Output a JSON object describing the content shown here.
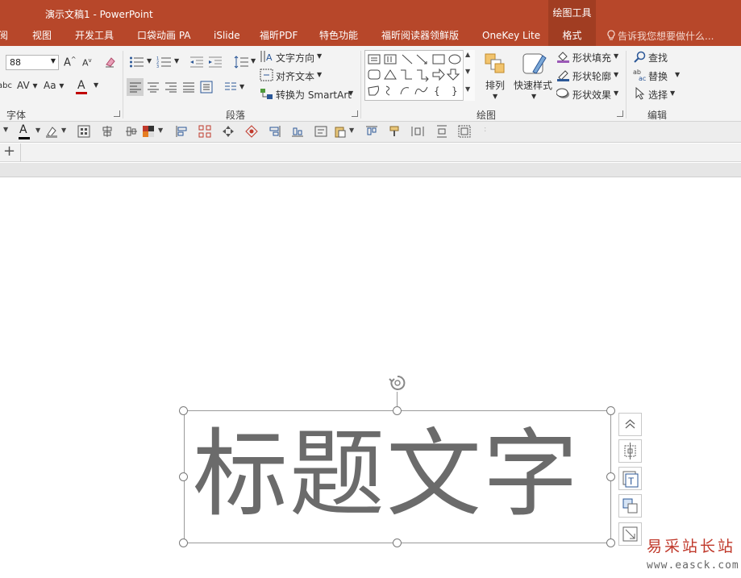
{
  "window": {
    "title": "演示文稿1 - PowerPoint",
    "context_tab_group": "绘图工具"
  },
  "tabs": [
    {
      "label": "阅"
    },
    {
      "label": "视图"
    },
    {
      "label": "开发工具"
    },
    {
      "label": "口袋动画 PA"
    },
    {
      "label": "iSlide"
    },
    {
      "label": "福昕PDF"
    },
    {
      "label": "特色功能"
    },
    {
      "label": "福昕阅读器领鲜版"
    },
    {
      "label": "OneKey Lite"
    },
    {
      "label": "格式"
    }
  ],
  "tell_me": "告诉我您想要做什么...",
  "ribbon": {
    "font": {
      "size_value": "88",
      "group_label": "字体"
    },
    "paragraph": {
      "text_direction": "文字方向",
      "align_text": "对齐文本",
      "convert_smartart": "转换为 SmartArt",
      "group_label": "段落"
    },
    "drawing": {
      "arrange": "排列",
      "quick_styles": "快速样式",
      "shape_fill": "形状填充",
      "shape_outline": "形状轮廓",
      "shape_effects": "形状效果",
      "group_label": "绘图"
    },
    "editing": {
      "find": "查找",
      "replace": "替换",
      "select": "选择",
      "group_label": "编辑"
    }
  },
  "slide": {
    "textbox_text": "标题文字"
  },
  "watermark": {
    "line1": "易采站长站",
    "line2": "www.easck.com"
  },
  "colors": {
    "titlebar": "#b7472a",
    "active_tab": "#a13d22",
    "ribbon_bg": "#f3f3f3",
    "textbox_text": "#6b6b6b",
    "font_color_bar": "#c00000"
  },
  "icons": [
    "grow-font-icon",
    "shrink-font-icon",
    "clear-format-icon",
    "bullets-icon",
    "numbering-icon",
    "decrease-indent-icon",
    "increase-indent-icon",
    "line-spacing-icon",
    "align-left-icon",
    "align-center-icon",
    "align-right-icon",
    "justify-icon",
    "columns-icon",
    "font-color-icon",
    "highlight-icon",
    "rotate-handle-icon",
    "add-slide-icon"
  ]
}
